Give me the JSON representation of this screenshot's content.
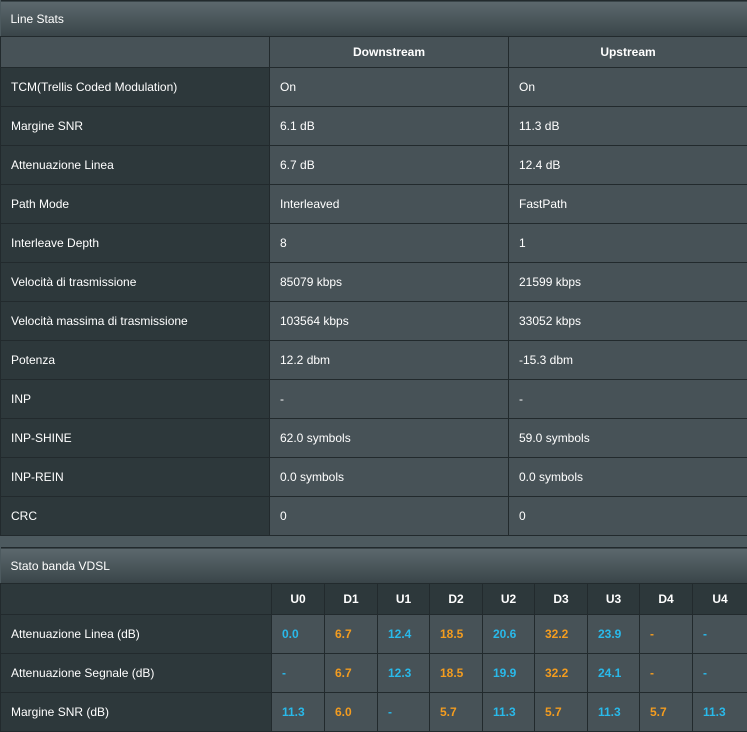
{
  "line_stats": {
    "title": "Line Stats",
    "columns": [
      "",
      "Downstream",
      "Upstream"
    ],
    "rows": [
      {
        "label": "TCM(Trellis Coded Modulation)",
        "down": "On",
        "up": "On"
      },
      {
        "label": "Margine SNR",
        "down": "6.1 dB",
        "up": "11.3 dB"
      },
      {
        "label": "Attenuazione Linea",
        "down": "6.7 dB",
        "up": "12.4 dB"
      },
      {
        "label": "Path Mode",
        "down": "Interleaved",
        "up": "FastPath"
      },
      {
        "label": "Interleave Depth",
        "down": "8",
        "up": "1"
      },
      {
        "label": "Velocità di trasmissione",
        "down": "85079 kbps",
        "up": "21599 kbps"
      },
      {
        "label": "Velocità massima di trasmissione",
        "down": "103564 kbps",
        "up": "33052 kbps"
      },
      {
        "label": "Potenza",
        "down": "12.2 dbm",
        "up": "-15.3 dbm"
      },
      {
        "label": "INP",
        "down": "-",
        "up": "-"
      },
      {
        "label": "INP-SHINE",
        "down": "62.0 symbols",
        "up": "59.0 symbols"
      },
      {
        "label": "INP-REIN",
        "down": "0.0 symbols",
        "up": "0.0 symbols"
      },
      {
        "label": "CRC",
        "down": "0",
        "up": "0"
      }
    ]
  },
  "vdsl_band": {
    "title": "Stato banda VDSL",
    "bands": [
      "U0",
      "D1",
      "U1",
      "D2",
      "U2",
      "D3",
      "U3",
      "D4",
      "U4"
    ],
    "rows": [
      {
        "label": "Attenuazione Linea (dB)",
        "values": [
          "0.0",
          "6.7",
          "12.4",
          "18.5",
          "20.6",
          "32.2",
          "23.9",
          "-",
          "-"
        ]
      },
      {
        "label": "Attenuazione Segnale (dB)",
        "values": [
          "-",
          "6.7",
          "12.3",
          "18.5",
          "19.9",
          "32.2",
          "24.1",
          "-",
          "-"
        ]
      },
      {
        "label": "Margine SNR (dB)",
        "values": [
          "11.3",
          "6.0",
          "-",
          "5.7",
          "11.3",
          "5.7",
          "11.3",
          "5.7",
          "11.3"
        ]
      }
    ]
  },
  "colors": {
    "upstream_value": "#29b9ea",
    "downstream_value": "#f39c1f",
    "label_background": "#2d383b",
    "value_background": "#475257"
  }
}
